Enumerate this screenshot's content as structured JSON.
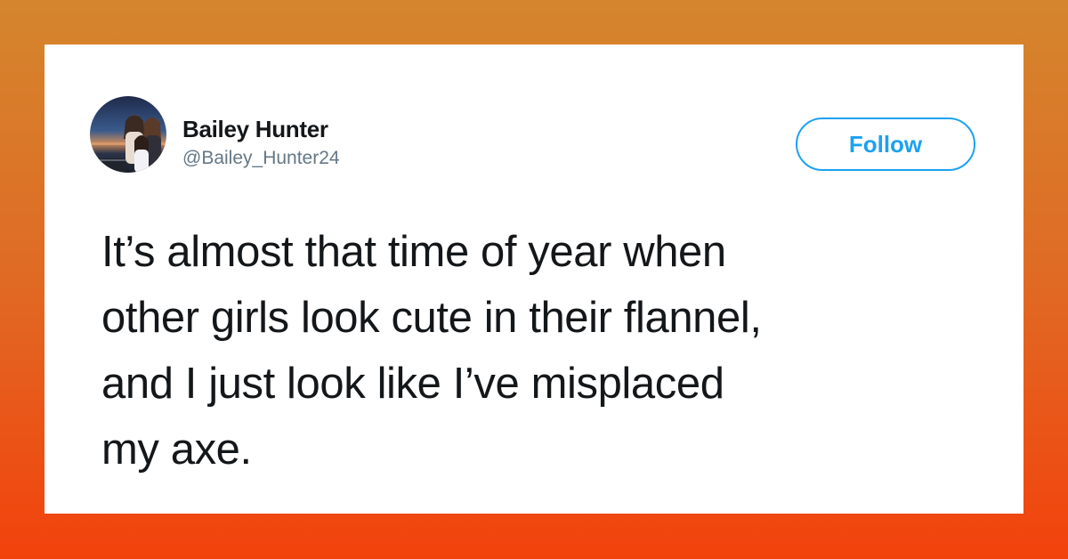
{
  "background": {
    "gradient_top": "#d4862e",
    "gradient_bottom": "#f2420c"
  },
  "tweet": {
    "author": {
      "display_name": "Bailey Hunter",
      "handle": "@Bailey_Hunter24",
      "avatar_icon": "profile-photo-avatar"
    },
    "follow_label": "Follow",
    "text_lines": [
      "It’s almost that time of year when",
      "other girls look cute in their flannel,",
      "and I just look like I’ve misplaced",
      "my axe."
    ],
    "accent_color": "#1da1f2"
  }
}
